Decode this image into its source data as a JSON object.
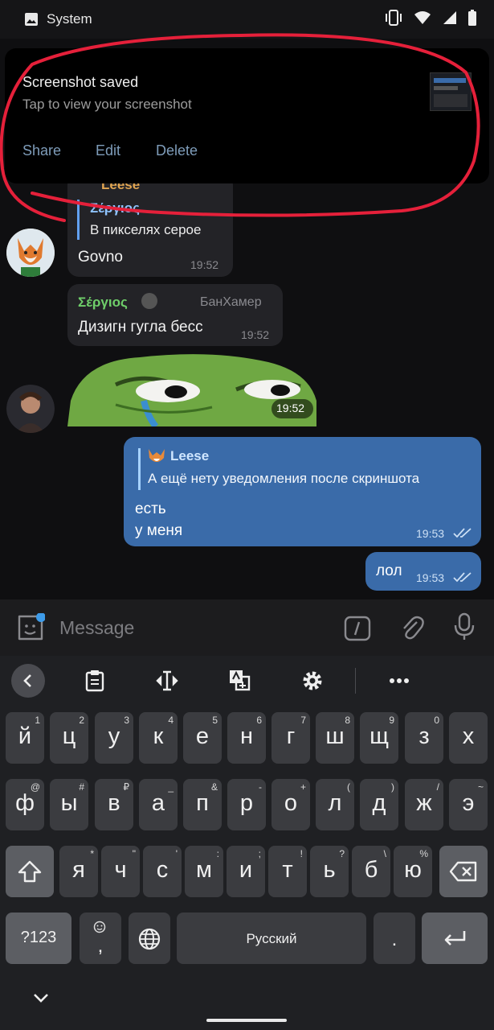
{
  "status_bar": {
    "app_name": "System",
    "icons": [
      "vibrate-icon",
      "wifi-icon",
      "signal-icon",
      "battery-icon"
    ]
  },
  "notification": {
    "title": "Screenshot saved",
    "text": "Tap to view your screenshot",
    "actions": [
      "Share",
      "Edit",
      "Delete"
    ]
  },
  "messages": {
    "m1": {
      "reply_sender_top": "Leese",
      "reply_name": "Σέργιος",
      "reply_text": "В пикселях серое",
      "text": "Govno",
      "time": "19:52"
    },
    "m2": {
      "sender": "Σέργιος",
      "badge": "БанХамер",
      "text": "Дизигн гугла бесс",
      "time": "19:52"
    },
    "m3": {
      "time": "19:52"
    },
    "m4": {
      "reply_name": "Leese",
      "reply_text": "А ещё нету уведомления после скриншота",
      "line1": "есть",
      "line2": "у меня",
      "time": "19:53"
    },
    "m5": {
      "text": "лол",
      "time": "19:53"
    }
  },
  "composer": {
    "placeholder": "Message"
  },
  "keyboard": {
    "row1": [
      [
        "й",
        "1"
      ],
      [
        "ц",
        "2"
      ],
      [
        "у",
        "3"
      ],
      [
        "к",
        "4"
      ],
      [
        "е",
        "5"
      ],
      [
        "н",
        "6"
      ],
      [
        "г",
        "7"
      ],
      [
        "ш",
        "8"
      ],
      [
        "щ",
        "9"
      ],
      [
        "з",
        "0"
      ],
      [
        "х",
        ""
      ]
    ],
    "row2": [
      [
        "ф",
        "@"
      ],
      [
        "ы",
        "#"
      ],
      [
        "в",
        "₽"
      ],
      [
        "а",
        "_"
      ],
      [
        "п",
        "&"
      ],
      [
        "р",
        "-"
      ],
      [
        "о",
        "+"
      ],
      [
        "л",
        "("
      ],
      [
        "д",
        ")"
      ],
      [
        "ж",
        "/"
      ],
      [
        "э",
        "~"
      ]
    ],
    "row3": [
      [
        "я",
        "*"
      ],
      [
        "ч",
        "\""
      ],
      [
        "с",
        "'"
      ],
      [
        "м",
        ":"
      ],
      [
        "и",
        ";"
      ],
      [
        "т",
        "!"
      ],
      [
        "ь",
        "?"
      ],
      [
        "б",
        "\\"
      ],
      [
        "ю",
        "%"
      ]
    ],
    "num_label": "?123",
    "emoji_comma": ",",
    "space_label": "Русский",
    "period": "."
  },
  "colors": {
    "accent": "#3a6ba9",
    "name_green": "#6fcf6a",
    "reply_blue": "#8fc4ff",
    "annotation_red": "#e5203a"
  }
}
